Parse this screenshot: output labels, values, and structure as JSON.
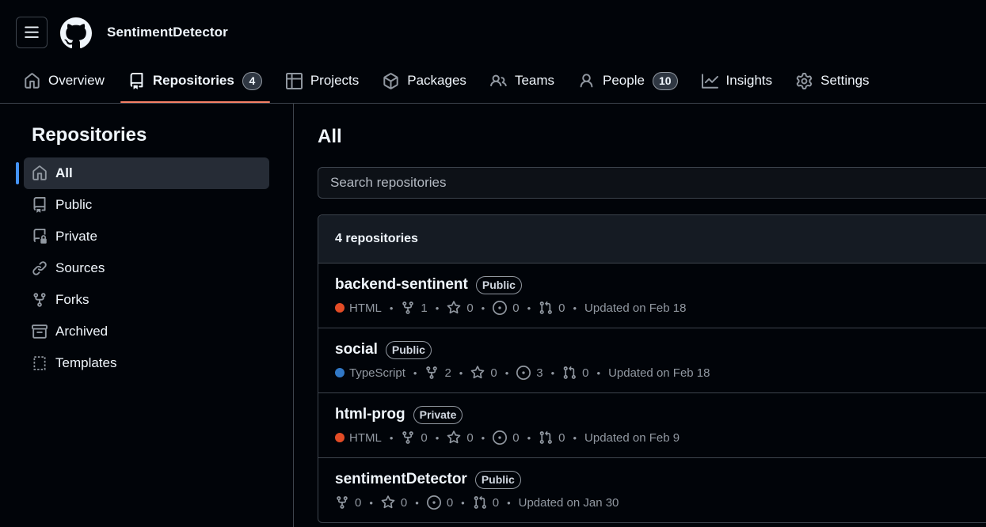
{
  "header": {
    "org_name": "SentimentDetector",
    "menu_icon": "hamburger-icon",
    "logo_icon": "github-logo"
  },
  "tabs": [
    {
      "label": "Overview",
      "icon": "home-icon"
    },
    {
      "label": "Repositories",
      "icon": "repo-icon",
      "count": "4",
      "active": true
    },
    {
      "label": "Projects",
      "icon": "table-icon"
    },
    {
      "label": "Packages",
      "icon": "package-icon"
    },
    {
      "label": "Teams",
      "icon": "people-icon"
    },
    {
      "label": "People",
      "icon": "person-icon",
      "count": "10"
    },
    {
      "label": "Insights",
      "icon": "graph-icon"
    },
    {
      "label": "Settings",
      "icon": "gear-icon"
    }
  ],
  "sidebar": {
    "title": "Repositories",
    "items": [
      {
        "label": "All",
        "icon": "home-icon",
        "active": true
      },
      {
        "label": "Public",
        "icon": "repo-icon"
      },
      {
        "label": "Private",
        "icon": "lock-repo-icon"
      },
      {
        "label": "Sources",
        "icon": "link-icon"
      },
      {
        "label": "Forks",
        "icon": "fork-icon"
      },
      {
        "label": "Archived",
        "icon": "archive-icon"
      },
      {
        "label": "Templates",
        "icon": "template-icon"
      }
    ]
  },
  "main": {
    "title": "All",
    "search_placeholder": "Search repositories",
    "count_label": "4 repositories",
    "repos": [
      {
        "name": "backend-sentinent",
        "visibility": "Public",
        "language": "HTML",
        "language_color": "#e34c26",
        "forks": "1",
        "stars": "0",
        "issues": "0",
        "pulls": "0",
        "updated": "Updated on Feb 18"
      },
      {
        "name": "social",
        "visibility": "Public",
        "language": "TypeScript",
        "language_color": "#3178c6",
        "forks": "2",
        "stars": "0",
        "issues": "3",
        "pulls": "0",
        "updated": "Updated on Feb 18"
      },
      {
        "name": "html-prog",
        "visibility": "Private",
        "language": "HTML",
        "language_color": "#e34c26",
        "forks": "0",
        "stars": "0",
        "issues": "0",
        "pulls": "0",
        "updated": "Updated on Feb 9"
      },
      {
        "name": "sentimentDetector",
        "visibility": "Public",
        "language": "",
        "language_color": "",
        "forks": "0",
        "stars": "0",
        "issues": "0",
        "pulls": "0",
        "updated": "Updated on Jan 30"
      }
    ]
  },
  "colors": {
    "background": "#010409",
    "border": "#3d444d",
    "active_tab_underline": "#f78166",
    "active_sidebar_marker": "#4493f8"
  }
}
